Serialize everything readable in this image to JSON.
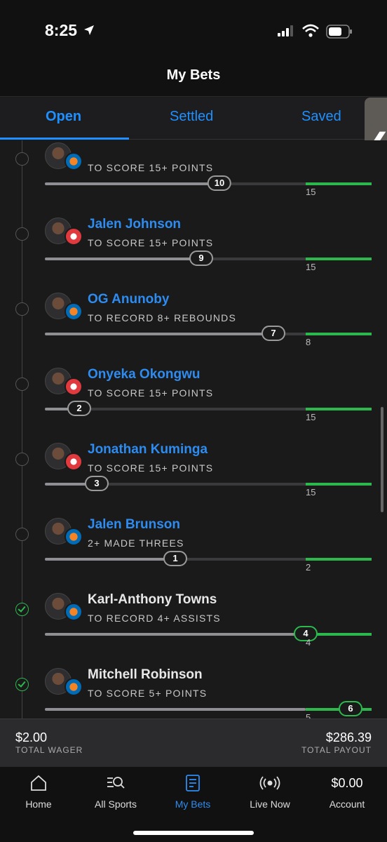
{
  "status": {
    "time": "8:25"
  },
  "header": {
    "title": "My Bets"
  },
  "tabs": [
    {
      "label": "Open"
    },
    {
      "label": "Settled"
    },
    {
      "label": "Saved"
    }
  ],
  "side_handle": {
    "glyph": "❮"
  },
  "legs": [
    {
      "name": "",
      "prop": "TO SCORE 15+ POINTS",
      "current": "10",
      "target": "15",
      "progress": 0.67,
      "team": "nyk",
      "done": false
    },
    {
      "name": "Jalen Johnson",
      "prop": "TO SCORE 15+ POINTS",
      "current": "9",
      "target": "15",
      "progress": 0.6,
      "team": "atl",
      "done": false
    },
    {
      "name": "OG Anunoby",
      "prop": "TO RECORD 8+ REBOUNDS",
      "current": "7",
      "target": "8",
      "progress": 0.875,
      "team": "nyk",
      "done": false
    },
    {
      "name": "Onyeka Okongwu",
      "prop": "TO SCORE 15+ POINTS",
      "current": "2",
      "target": "15",
      "progress": 0.133,
      "team": "atl",
      "done": false
    },
    {
      "name": "Jonathan Kuminga",
      "prop": "TO SCORE 15+ POINTS",
      "current": "3",
      "target": "15",
      "progress": 0.2,
      "team": "atl",
      "done": false
    },
    {
      "name": "Jalen Brunson",
      "prop": "2+ MADE THREES",
      "current": "1",
      "target": "2",
      "progress": 0.5,
      "team": "nyk",
      "done": false
    },
    {
      "name": "Karl-Anthony Towns",
      "prop": "TO RECORD 4+ ASSISTS",
      "current": "4",
      "target": "4",
      "progress": 1.0,
      "team": "nyk",
      "done": true
    },
    {
      "name": "Mitchell Robinson",
      "prop": "TO SCORE 5+ POINTS",
      "current": "6",
      "target": "5",
      "progress": 1.2,
      "team": "nyk",
      "done": true
    }
  ],
  "footer": {
    "wager_value": "$2.00",
    "wager_label": "TOTAL WAGER",
    "payout_value": "$286.39",
    "payout_label": "TOTAL PAYOUT"
  },
  "bottom_nav": [
    {
      "label": "Home",
      "icon": "home-icon"
    },
    {
      "label": "All Sports",
      "icon": "search-sports-icon"
    },
    {
      "label": "My Bets",
      "icon": "bet-slip-icon",
      "active": true
    },
    {
      "label": "Live Now",
      "icon": "live-broadcast-icon"
    },
    {
      "label": "Account",
      "icon": "account-balance",
      "balance": "$0.00"
    }
  ],
  "colors": {
    "accent": "#2e8cf0",
    "success": "#2db84d",
    "background": "#1a1a1b"
  }
}
